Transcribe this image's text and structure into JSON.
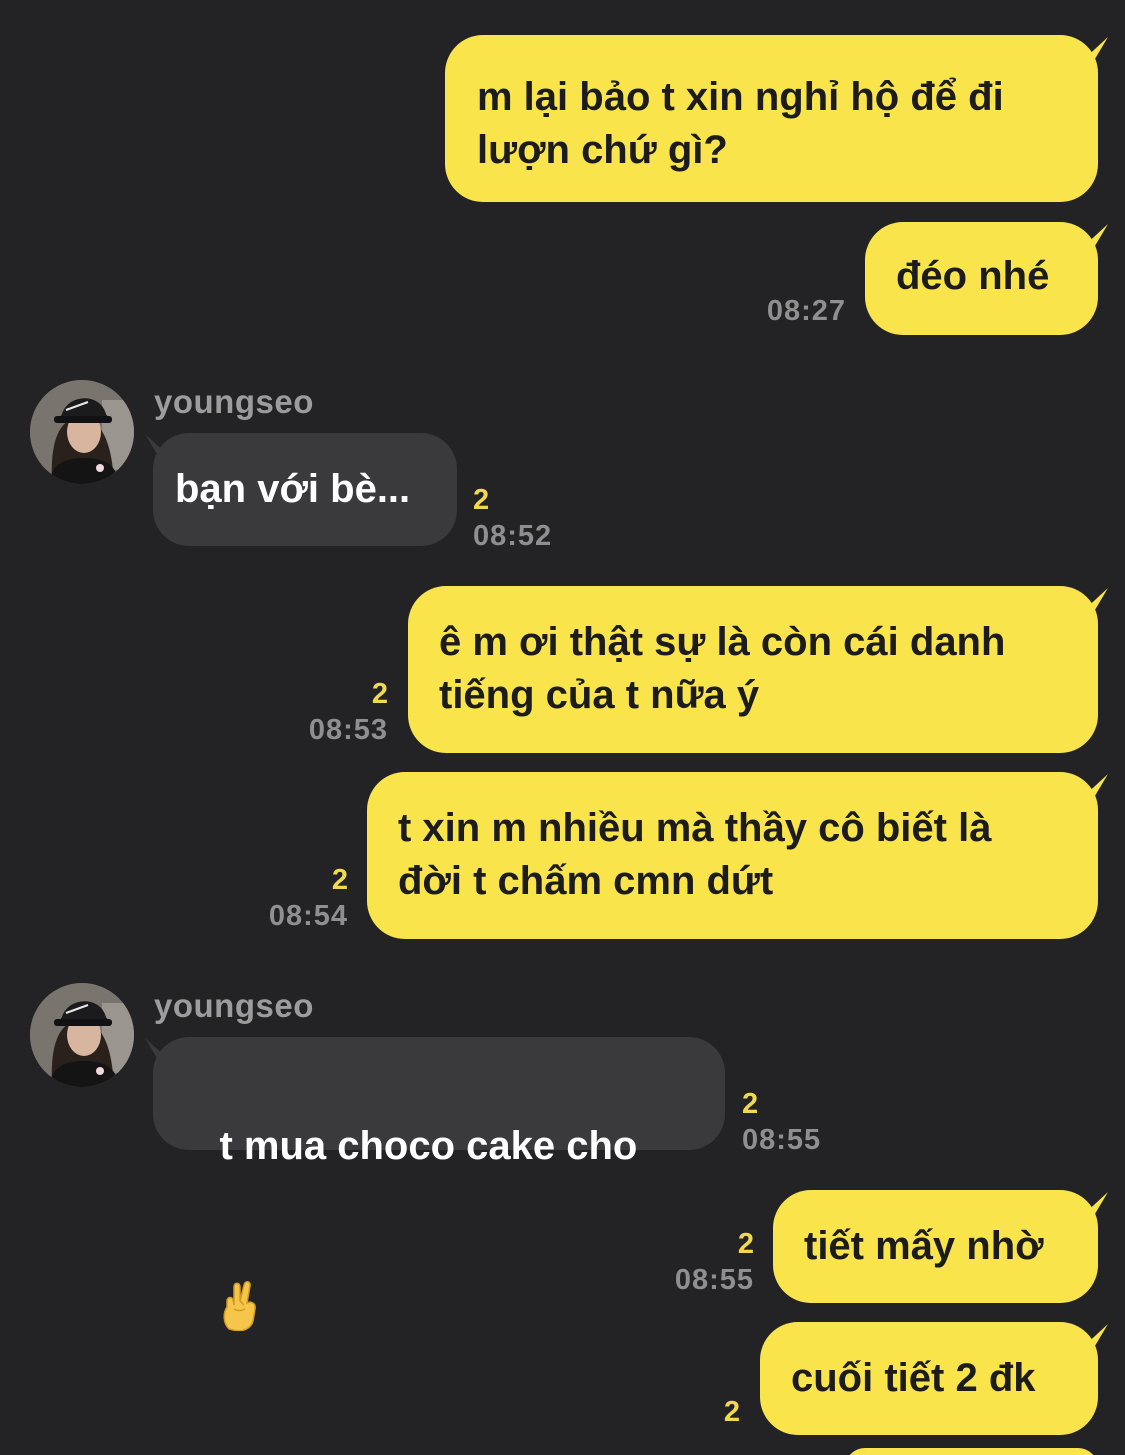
{
  "theme": {
    "background": "#232325",
    "outgoing_bubble": "#f9e44c",
    "incoming_bubble": "#3a3a3c",
    "unread_color": "#f2d94b",
    "time_color": "#8e8e93"
  },
  "messages": [
    {
      "direction": "out",
      "text": "m lại bảo t xin nghỉ hộ để đi\nlượn chứ gì?"
    },
    {
      "direction": "out",
      "text": "đéo nhé",
      "time": "08:27"
    },
    {
      "direction": "in",
      "sender": "youngseo",
      "text": "bạn với bè...",
      "unread": "2",
      "time": "08:52"
    },
    {
      "direction": "out",
      "text": "ê m ơi thật sự là còn cái danh\ntiếng của t nữa ý",
      "unread": "2",
      "time": "08:53"
    },
    {
      "direction": "out",
      "text": "t xin m nhiều mà thầy cô biết là\nđời t chấm cmn dứt",
      "unread": "2",
      "time": "08:54"
    },
    {
      "direction": "in",
      "sender": "youngseo",
      "text": "t mua choco cake cho",
      "emoji": "crossed-fingers-emoji",
      "unread": "2",
      "time": "08:55"
    },
    {
      "direction": "out",
      "text": "tiết mấy nhờ",
      "unread": "2",
      "time": "08:55"
    },
    {
      "direction": "out",
      "text": "cuối tiết 2 đk",
      "unread": "2"
    }
  ]
}
